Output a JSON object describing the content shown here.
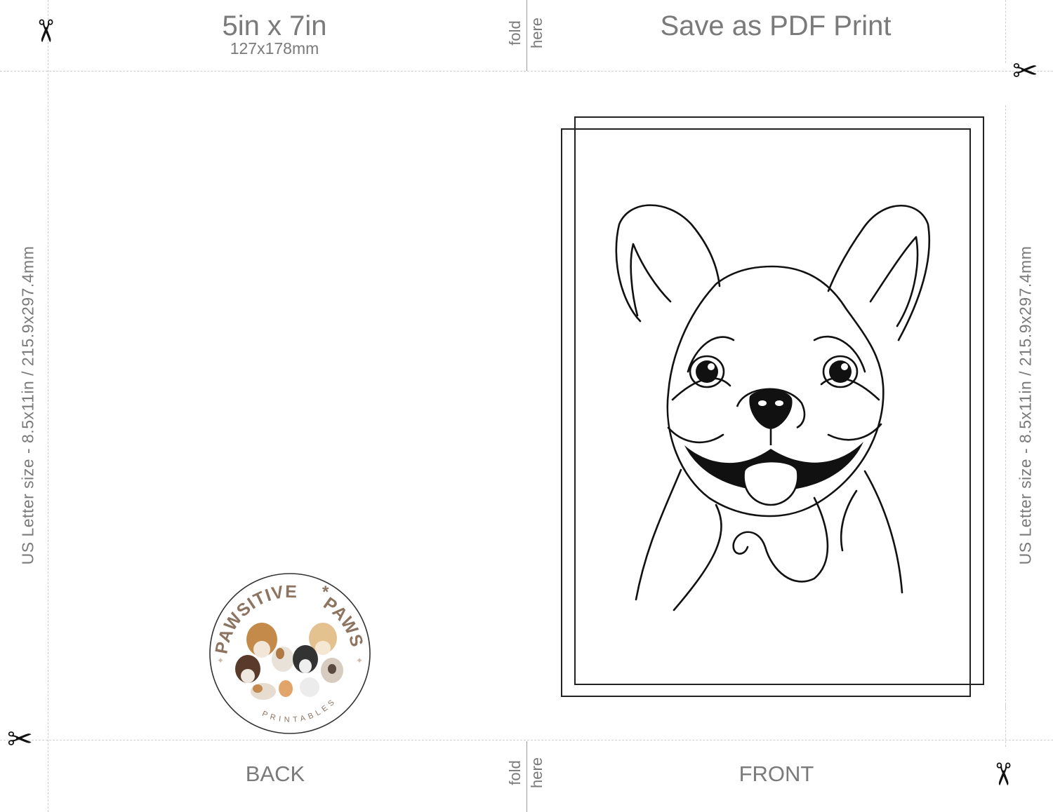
{
  "header": {
    "card_size": "5in x 7in",
    "card_size_metric": "127x178mm",
    "title": "Save as PDF Print"
  },
  "fold": {
    "word1": "fold",
    "word2": "here"
  },
  "sides": {
    "back": "BACK",
    "front": "FRONT"
  },
  "paper": {
    "size_label": "US Letter size - 8.5x11in / 215.9x297.4mm"
  },
  "logo": {
    "name_left": "PAWSITIVE",
    "separator": "*",
    "name_right": "PAWS",
    "subtitle": "PRINTABLES"
  },
  "icons": {
    "cut_marks": "scissors-icon",
    "front_illustration": "french-bulldog-line-art"
  },
  "colors": {
    "guide_text": "#7a7a7a",
    "logo_brown": "#8c7461",
    "line_art": "#111111"
  }
}
